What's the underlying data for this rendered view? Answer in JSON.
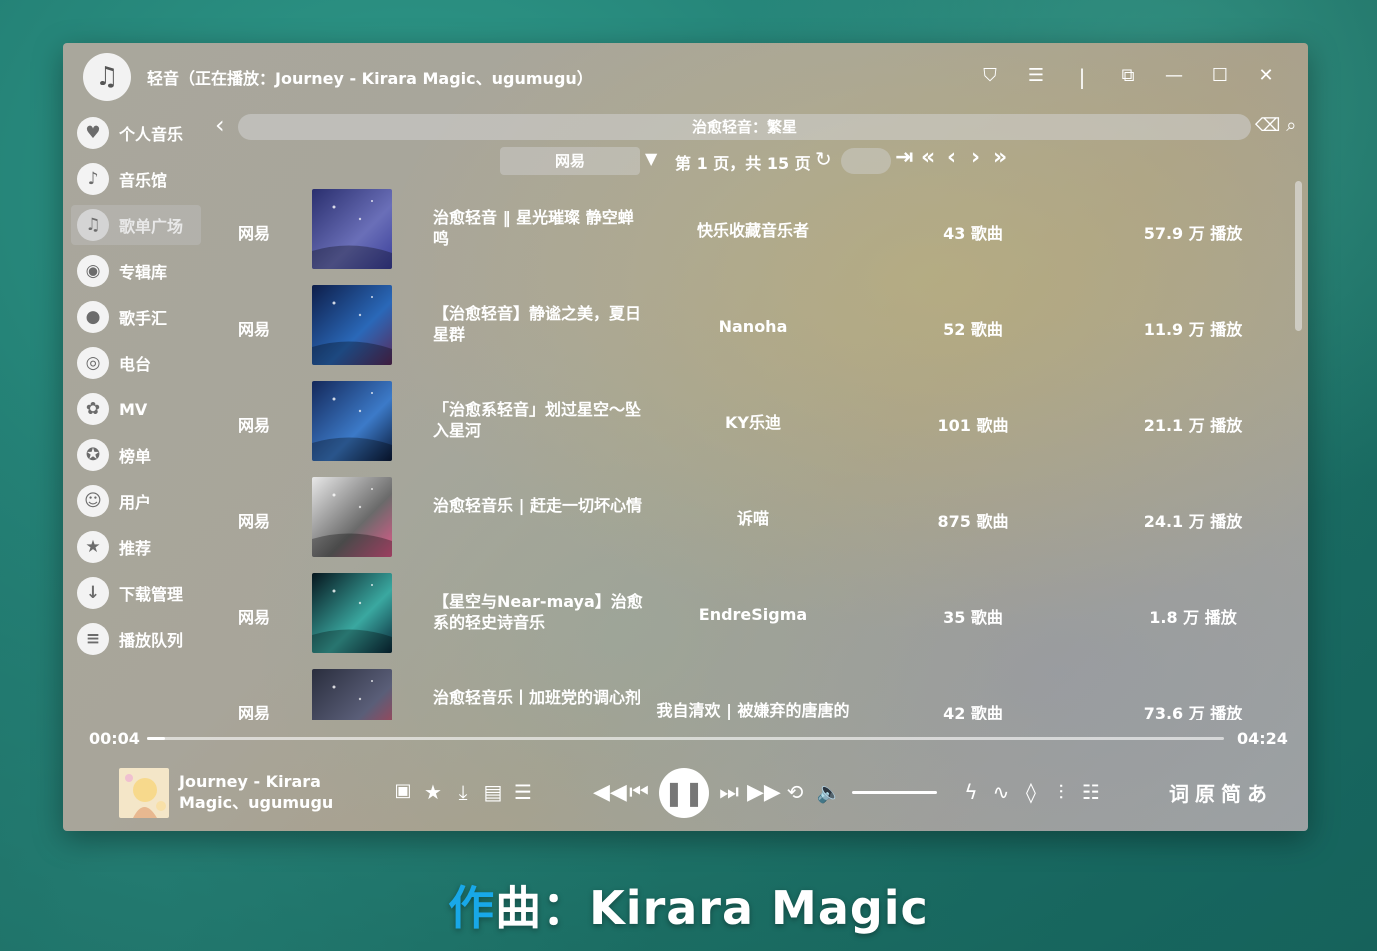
{
  "window": {
    "title": "轻音（正在播放：Journey - Kirara Magic、ugumugu）",
    "logo_icon": "music-note-icon",
    "controls": [
      "shirt-icon",
      "menu-icon",
      "divider",
      "mini-mode-icon",
      "minimize-icon",
      "maximize-icon",
      "close-icon"
    ]
  },
  "sidebar": {
    "items": [
      {
        "label": "个人音乐",
        "icon": "heart-icon",
        "glyph": "♥"
      },
      {
        "label": "音乐馆",
        "icon": "music-note-icon",
        "glyph": "♪"
      },
      {
        "label": "歌单广场",
        "icon": "playlist-icon",
        "glyph": "♫",
        "active": true
      },
      {
        "label": "专辑库",
        "icon": "disc-icon",
        "glyph": "◉"
      },
      {
        "label": "歌手汇",
        "icon": "singer-icon",
        "glyph": "●"
      },
      {
        "label": "电台",
        "icon": "radio-icon",
        "glyph": "◎"
      },
      {
        "label": "MV",
        "icon": "film-reel-icon",
        "glyph": "✿"
      },
      {
        "label": "榜单",
        "icon": "ranking-icon",
        "glyph": "✪"
      },
      {
        "label": "用户",
        "icon": "user-icon",
        "glyph": "☺"
      },
      {
        "label": "推荐",
        "icon": "star-icon",
        "glyph": "★"
      },
      {
        "label": "下载管理",
        "icon": "download-icon",
        "glyph": "↓"
      },
      {
        "label": "播放队列",
        "icon": "queue-icon",
        "glyph": "≡"
      }
    ]
  },
  "search": {
    "query": "治愈轻音：繁星"
  },
  "pager": {
    "source": "网易",
    "page_info": "第 1 页，共 15 页"
  },
  "playlists": [
    {
      "source": "网易",
      "name": "治愈轻音 ‖ 星光璀璨 静空蝉鸣",
      "author": "快乐收藏音乐者",
      "count": "43 歌曲",
      "plays": "57.9 万 播放",
      "cover": [
        "#2a2f6e",
        "#6a6fb8",
        "#3b3f9a"
      ]
    },
    {
      "source": "网易",
      "name": "【治愈轻音】静谧之美，夏日星群",
      "author": "Nanoha",
      "count": "52 歌曲",
      "plays": "11.9 万 播放",
      "cover": [
        "#0e1e4a",
        "#2a68b8",
        "#5a2a5a"
      ]
    },
    {
      "source": "网易",
      "name": "「治愈系轻音」划过星空～坠入星河",
      "author": "KY乐迪",
      "count": "101 歌曲",
      "plays": "21.1 万 播放",
      "cover": [
        "#14285a",
        "#3c7ac8",
        "#0a1a3a"
      ]
    },
    {
      "source": "网易",
      "name": "治愈轻音乐 | 赶走一切坏心情",
      "author": "诉喵",
      "count": "875 歌曲",
      "plays": "24.1 万 播放",
      "cover": [
        "#e8e8e8",
        "#6a6a6a",
        "#e05a8a"
      ]
    },
    {
      "source": "网易",
      "name": "【星空与Near-maya】治愈系的轻史诗音乐",
      "author": "EndreSigma",
      "count": "35 歌曲",
      "plays": "1.8 万 播放",
      "cover": [
        "#06161e",
        "#3aa8a0",
        "#0a2a3a"
      ]
    },
    {
      "source": "网易",
      "name": "治愈轻音乐丨加班党的调心剂",
      "author": "我自清欢 | 被嫌弃的唐唐的一生",
      "count": "42 歌曲",
      "plays": "73.6 万 播放",
      "cover": [
        "#2a2e3e",
        "#5a5e78",
        "#c03a4a"
      ]
    }
  ],
  "progress": {
    "current": "00:04",
    "total": "04:24",
    "fraction": 0.017
  },
  "now_playing": {
    "title": "Journey - Kirara Magic、ugumugu"
  },
  "lyric_buttons": [
    "词",
    "原",
    "简",
    "あ"
  ],
  "caption": {
    "accent": "作",
    "rest": "曲：Kirara Magic"
  },
  "colors": {
    "accent": "#18a8e8"
  }
}
